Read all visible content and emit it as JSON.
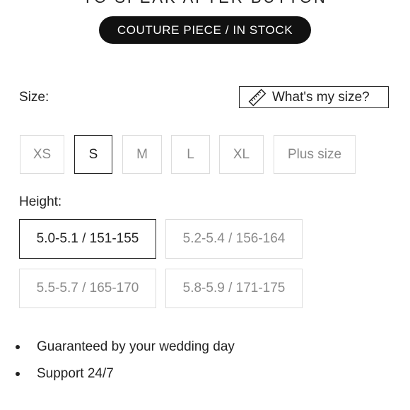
{
  "header": {
    "title_cut": "TO SPEAK AFTER BUTTON",
    "badge": "COUTURE PIECE / IN STOCK"
  },
  "size": {
    "label": "Size:",
    "guide_button": "What's my size?",
    "guide_icon": "ruler-icon",
    "options": [
      "XS",
      "S",
      "M",
      "L",
      "XL",
      "Plus size"
    ],
    "selected": "S"
  },
  "height": {
    "label": "Height:",
    "options": [
      "5.0-5.1 / 151-155",
      "5.2-5.4 / 156-164",
      "5.5-5.7 / 165-170",
      "5.8-5.9 / 171-175"
    ],
    "selected": "5.0-5.1 / 151-155"
  },
  "features": [
    "Guaranteed by your wedding day",
    "Support 24/7"
  ],
  "colors": {
    "badge_bg": "#111111",
    "selected_border": "#222222",
    "unselected_border": "#dcdcdc",
    "unselected_text": "#8a8a8a"
  }
}
